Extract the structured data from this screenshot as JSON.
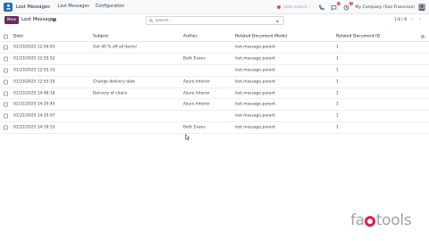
{
  "navbar": {
    "brand": "Lost Messages",
    "menus": [
      "Lost Messages",
      "Configuration"
    ],
    "search_placeholder": "Idalo search...",
    "badges": {
      "messages": "1",
      "activities": "1"
    },
    "company": "My Company (San Francisco)"
  },
  "control_panel": {
    "new_label": "New",
    "title": "Lost Messages",
    "search_placeholder": "Search...",
    "pager": "1-8 / 8",
    "pager_prev": "‹",
    "pager_next": "›"
  },
  "table": {
    "columns": [
      "Date",
      "Subject",
      "Author",
      "Related Document Model",
      "Related Document ID"
    ],
    "rows": [
      {
        "date": "01/23/2025 12:56:03",
        "subject": "Get 40 % off all Items!",
        "author": "",
        "model": "lost.message.parent",
        "res_id": "1"
      },
      {
        "date": "01/23/2025 12:55:52",
        "subject": "",
        "author": "Beth Evans",
        "model": "lost.message.parent",
        "res_id": "1"
      },
      {
        "date": "01/23/2025 12:55:33",
        "subject": "",
        "author": "",
        "model": "lost.message.parent",
        "res_id": "1"
      },
      {
        "date": "01/23/2025 12:55:19",
        "subject": "Change delivery date",
        "author": "Azure Interior",
        "model": "lost.message.parent",
        "res_id": "1"
      },
      {
        "date": "01/23/2025 14:48:18",
        "subject": "Delivery of chairs",
        "author": "Azure Interior",
        "model": "lost.message.parent",
        "res_id": "1"
      },
      {
        "date": "01/22/2025 14:20:45",
        "subject": "",
        "author": "Azure Interior",
        "model": "lost.message.parent",
        "res_id": "1"
      },
      {
        "date": "01/22/2025 14:20:07",
        "subject": "",
        "author": "",
        "model": "lost.message.parent",
        "res_id": "1"
      },
      {
        "date": "01/22/2025 14:19:52",
        "subject": "",
        "author": "Beth Evans",
        "model": "lost.message.parent",
        "res_id": "1"
      }
    ]
  },
  "watermark": {
    "left": "fa",
    "right": "tools"
  },
  "colors": {
    "primary": "#6b2d5c",
    "brand_icon": "#1e6fb8",
    "watermark_o": "#e11d48"
  }
}
